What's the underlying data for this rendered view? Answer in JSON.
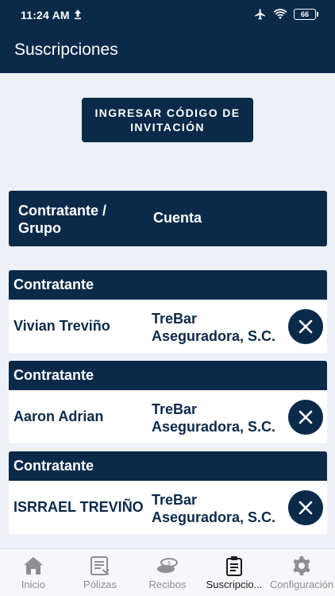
{
  "status_bar": {
    "time": "11:24 AM",
    "battery": "66",
    "icons": [
      "upload-icon",
      "airplane-icon",
      "wifi-icon",
      "battery-icon"
    ]
  },
  "app_bar": {
    "title": "Suscripciones"
  },
  "invite_button": {
    "label": "INGRESAR CÓDIGO DE INVITACIÓN"
  },
  "table_header": {
    "col1": "Contratante / Grupo",
    "col2": "Cuenta"
  },
  "subscriptions": [
    {
      "header": "Contratante",
      "name": "Vivian Treviño",
      "account": "TreBar Aseguradora, S.C."
    },
    {
      "header": "Contratante",
      "name": "Aaron Adrian",
      "account": "TreBar Aseguradora, S.C."
    },
    {
      "header": "Contratante",
      "name": "ISRRAEL TREVIÑO",
      "account": "TreBar Aseguradora, S.C."
    }
  ],
  "bottom_nav": {
    "items": [
      {
        "label": "Inicio",
        "icon": "home-icon"
      },
      {
        "label": "Pólizas",
        "icon": "policy-document-icon"
      },
      {
        "label": "Recibos",
        "icon": "coins-icon"
      },
      {
        "label": "Suscripcio...",
        "icon": "clipboard-icon",
        "active": true
      },
      {
        "label": "Configuración",
        "icon": "gear-icon"
      }
    ]
  },
  "colors": {
    "primary": "#0b2a4a",
    "background": "#eef0f7",
    "card": "#ffffff",
    "nav_inactive": "#8e8e93"
  }
}
